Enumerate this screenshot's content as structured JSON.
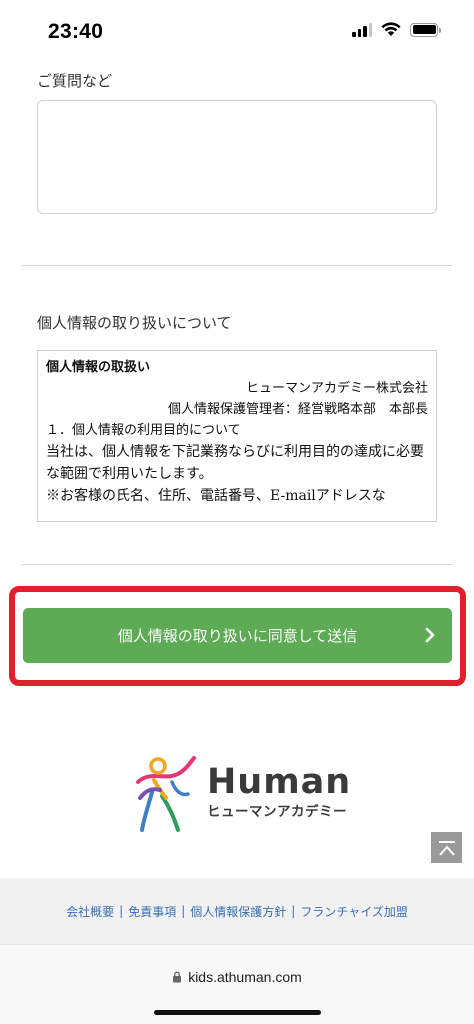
{
  "status_bar": {
    "time": "23:40"
  },
  "form": {
    "question_label": "ご質問など",
    "question_value": "",
    "privacy_label": "個人情報の取り扱いについて"
  },
  "policy": {
    "title": "個人情報の取扱い",
    "company": "ヒューマンアカデミー株式会社",
    "manager": "個人情報保護管理者：経営戦略本部　本部長",
    "section1": "１．個人情報の利用目的について",
    "body1": "当社は、個人情報を下記業務ならびに利用目的の達成に必要な範囲で利用いたします。",
    "body2": "※お客様の氏名、住所、電話番号、E-mailアドレスな"
  },
  "submit": {
    "label": "個人情報の取り扱いに同意して送信",
    "highlight_color": "#e0202c",
    "button_color": "#5dab55"
  },
  "logo": {
    "wordmark": "Human",
    "subtitle": "ヒューマンアカデミー"
  },
  "footer": {
    "links": [
      "会社概要",
      "免責事項",
      "個人情報保護方針",
      "フランチャイズ加盟"
    ],
    "link_color": "#3a6fb3"
  },
  "browser": {
    "url": "kids.athuman.com"
  },
  "icons": {
    "signal": "cellular-signal-icon",
    "wifi": "wifi-icon",
    "battery": "battery-icon",
    "lock": "lock-icon",
    "chevron": "chevron-right-icon",
    "back_to_top": "back-to-top-icon"
  }
}
